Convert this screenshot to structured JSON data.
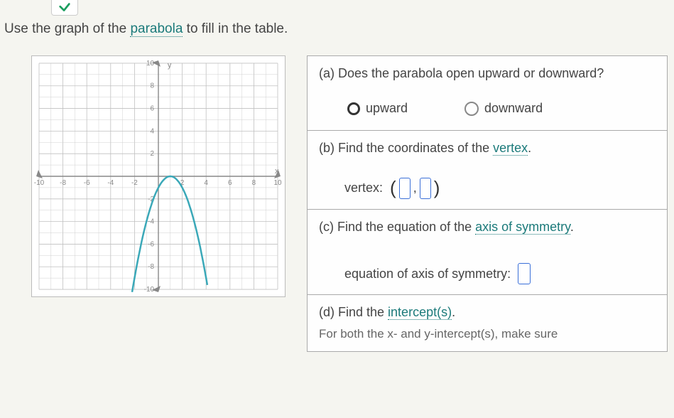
{
  "instruction_pre": "Use the graph of the ",
  "instruction_link": "parabola",
  "instruction_post": " to fill in the table.",
  "parts": {
    "a": {
      "prompt": "(a) Does the parabola open upward or downward?",
      "opt1": "upward",
      "opt2": "downward"
    },
    "b": {
      "prompt_pre": "(b) Find the coordinates of the ",
      "prompt_link": "vertex",
      "prompt_post": ".",
      "label": "vertex:"
    },
    "c": {
      "prompt_pre": "(c) Find the equation of the ",
      "prompt_link": "axis of symmetry",
      "prompt_post": ".",
      "label": "equation of axis of symmetry:"
    },
    "d": {
      "prompt_pre": "(d) Find the ",
      "prompt_link": "intercept(s)",
      "prompt_post": ".",
      "hint": "For both the x- and y-intercept(s), make sure"
    }
  },
  "chart_data": {
    "type": "line",
    "title": "",
    "xlabel": "x",
    "ylabel": "y",
    "xlim": [
      -10,
      10
    ],
    "ylim": [
      -10,
      10
    ],
    "x_ticks": [
      -10,
      -8,
      -6,
      -4,
      -2,
      2,
      4,
      6,
      8,
      10
    ],
    "y_ticks": [
      -10,
      -8,
      -6,
      -4,
      -2,
      2,
      4,
      6,
      8,
      10
    ],
    "series": [
      {
        "name": "parabola",
        "equation": "y = -(x-1)^2",
        "vertex": [
          1,
          0
        ],
        "points": [
          [
            -2.2,
            -10.24
          ],
          [
            -2,
            -9
          ],
          [
            -1,
            -4
          ],
          [
            0,
            -1
          ],
          [
            1,
            0
          ],
          [
            2,
            -1
          ],
          [
            3,
            -4
          ],
          [
            4,
            -9
          ],
          [
            4.2,
            -10.24
          ]
        ]
      }
    ]
  }
}
